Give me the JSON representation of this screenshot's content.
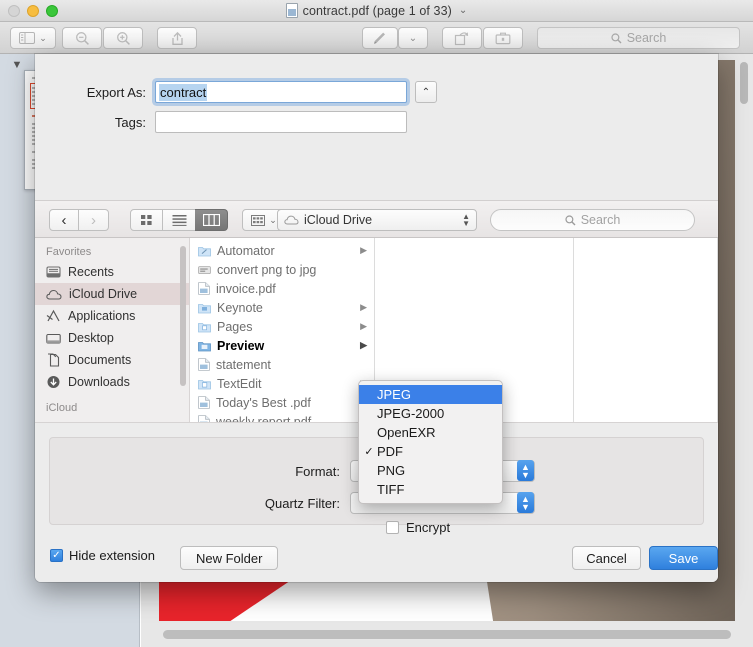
{
  "window": {
    "title": "contract.pdf (page 1 of 33)",
    "title_chevron": "⌄",
    "traffic_lights": [
      "close",
      "minimize",
      "maximize"
    ],
    "toolbar": {
      "sidebar_toggle": "sidebar-icon",
      "sidebar_chevron": "⌄",
      "zoom_out": "zoom-out-icon",
      "zoom_in": "zoom-in-icon",
      "share": "share-icon",
      "markup": "markup-pen-icon",
      "markup_chevron": "⌄",
      "rotate": "rotate-icon",
      "toolbox": "toolbox-icon",
      "search_placeholder": "Search",
      "search_value": ""
    },
    "thumbnail_collapse": "▼"
  },
  "sheet": {
    "export_as": {
      "label": "Export As:",
      "value": "contract",
      "placeholder": "",
      "expand_chevron": "⌃"
    },
    "tags": {
      "label": "Tags:",
      "value": "",
      "placeholder": ""
    },
    "nav": {
      "back": "‹",
      "forward": "›",
      "view_icon": "icon-view-icon",
      "view_list": "list-view-icon",
      "view_column": "column-view-icon",
      "active_view": "column",
      "group_icon": "group-by-icon",
      "group_chevron": "⌄",
      "location": "iCloud Drive",
      "location_icon": "cloud-icon",
      "location_chevron": "⌃⌄",
      "search_placeholder": "Search",
      "search_value": ""
    },
    "sidebar": {
      "sections": [
        {
          "header": "Favorites",
          "items": [
            {
              "label": "Recents",
              "icon": "recents-icon",
              "active": false
            },
            {
              "label": "iCloud Drive",
              "icon": "cloud-icon",
              "active": true
            },
            {
              "label": "Applications",
              "icon": "applications-icon",
              "active": false
            },
            {
              "label": "Desktop",
              "icon": "desktop-icon",
              "active": false
            },
            {
              "label": "Documents",
              "icon": "documents-icon",
              "active": false
            },
            {
              "label": "Downloads",
              "icon": "downloads-icon",
              "active": false
            }
          ]
        },
        {
          "header": "iCloud",
          "items": []
        }
      ]
    },
    "files": [
      {
        "name": "Automator",
        "icon": "folder-automator-icon",
        "has_arrow": true,
        "selected": false
      },
      {
        "name": "convert png to jpg",
        "icon": "workflow-icon",
        "has_arrow": false,
        "selected": false
      },
      {
        "name": "invoice.pdf",
        "icon": "pdf-icon",
        "has_arrow": false,
        "selected": false
      },
      {
        "name": "Keynote",
        "icon": "folder-keynote-icon",
        "has_arrow": true,
        "selected": false
      },
      {
        "name": "Pages",
        "icon": "folder-pages-icon",
        "has_arrow": true,
        "selected": false
      },
      {
        "name": "Preview",
        "icon": "folder-preview-icon",
        "has_arrow": true,
        "selected": true
      },
      {
        "name": "statement",
        "icon": "pdf-icon",
        "has_arrow": false,
        "selected": false
      },
      {
        "name": "TextEdit",
        "icon": "folder-textedit-icon",
        "has_arrow": true,
        "selected": false
      },
      {
        "name": "Today's Best .pdf",
        "icon": "pdf-icon",
        "has_arrow": false,
        "selected": false
      },
      {
        "name": "weekly report.pdf",
        "icon": "pdf-icon",
        "has_arrow": false,
        "selected": false
      }
    ],
    "options": {
      "format_label": "Format:",
      "quartz_label": "Quartz Filter:",
      "encrypt_label": "Encrypt",
      "encrypt_checked": false
    },
    "format_menu": {
      "items": [
        {
          "label": "JPEG",
          "checked": false,
          "highlighted": true
        },
        {
          "label": "JPEG-2000",
          "checked": false,
          "highlighted": false
        },
        {
          "label": "OpenEXR",
          "checked": false,
          "highlighted": false
        },
        {
          "label": "PDF",
          "checked": true,
          "highlighted": false
        },
        {
          "label": "PNG",
          "checked": false,
          "highlighted": false
        },
        {
          "label": "TIFF",
          "checked": false,
          "highlighted": false
        }
      ],
      "check_glyph": "✓"
    },
    "footer": {
      "hide_extension_label": "Hide extension",
      "hide_extension_checked": true,
      "check_glyph": "✓",
      "new_folder_label": "New Folder",
      "cancel_label": "Cancel",
      "save_label": "Save"
    }
  },
  "colors": {
    "accent_blue": "#2f80dd",
    "menu_highlight": "#3b80e8",
    "selection_blue": "#b6d4f0",
    "sidebar_active": "#e2d6d6"
  }
}
